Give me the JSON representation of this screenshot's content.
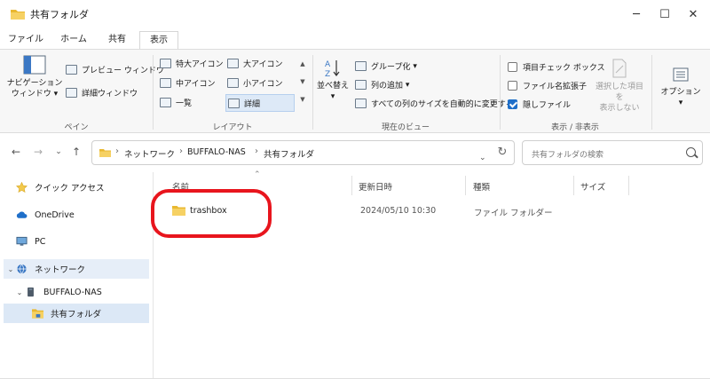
{
  "window": {
    "title": "共有フォルダ",
    "minimize_icon": "minimize-icon",
    "maximize_icon": "maximize-icon",
    "close_icon": "close-icon"
  },
  "tabs": [
    {
      "label": "ファイル"
    },
    {
      "label": "ホーム"
    },
    {
      "label": "共有"
    },
    {
      "label": "表示",
      "active": true
    }
  ],
  "ribbon": {
    "pane": {
      "nav_pane_line1": "ナビゲーション",
      "nav_pane_line2": "ウィンドウ",
      "preview": "プレビュー ウィンドウ",
      "details_pane": "詳細ウィンドウ",
      "label": "ペイン"
    },
    "layout": {
      "items": [
        "特大アイコン",
        "大アイコン",
        "中アイコン",
        "小アイコン",
        "一覧",
        "詳細"
      ],
      "selected": "詳細",
      "label": "レイアウト"
    },
    "current_view": {
      "sort_line1": "並べ替え",
      "group": "グループ化",
      "add_column": "列の追加",
      "fit_columns": "すべての列のサイズを自動的に変更する",
      "label": "現在のビュー"
    },
    "show_hide": {
      "item_checkbox": "項目チェック ボックス",
      "extensions": "ファイル名拡張子",
      "hidden_files": "隠しファイル",
      "hide_selected_line1": "選択した項目を",
      "hide_selected_line2": "表示しない",
      "label": "表示 / 非表示"
    },
    "options": {
      "label": "オプション"
    }
  },
  "address": {
    "crumbs": [
      "ネットワーク",
      "BUFFALO-NAS",
      "共有フォルダ"
    ],
    "search_placeholder": "共有フォルダの検索"
  },
  "sidebar": {
    "items": [
      {
        "label": "クイック アクセス",
        "icon": "star-icon"
      },
      {
        "label": "OneDrive",
        "icon": "cloud-icon"
      },
      {
        "label": "PC",
        "icon": "monitor-icon"
      },
      {
        "label": "ネットワーク",
        "icon": "network-icon"
      },
      {
        "label": "BUFFALO-NAS",
        "icon": "nas-icon"
      },
      {
        "label": "共有フォルダ",
        "icon": "folder-icon"
      }
    ]
  },
  "columns": [
    "名前",
    "更新日時",
    "種類",
    "サイズ"
  ],
  "rows": [
    {
      "name": "trashbox",
      "modified": "2024/05/10 10:30",
      "type": "ファイル フォルダー",
      "size": ""
    }
  ],
  "colors": {
    "accent": "#1f6fc9",
    "selection": "#e6eef8",
    "highlight_ring": "#e8151d",
    "folder": "#f2c94c"
  }
}
